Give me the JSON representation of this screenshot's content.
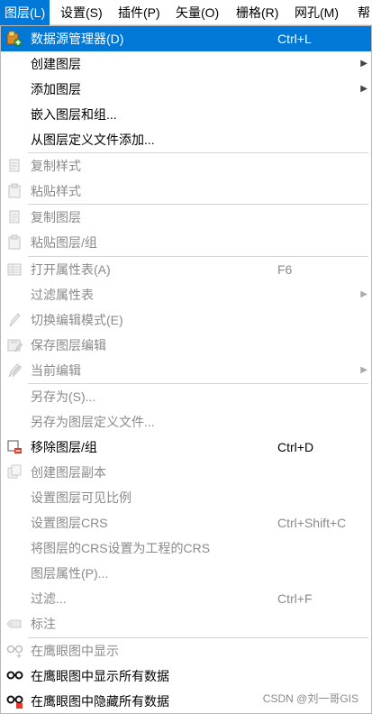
{
  "menubar": {
    "items": [
      "图层(L)",
      "设置(S)",
      "插件(P)",
      "矢量(O)",
      "栅格(R)",
      "网孔(M)",
      "帮"
    ]
  },
  "menu": {
    "items": [
      {
        "label": "数据源管理器(D)",
        "shortcut": "Ctrl+L",
        "icon": "data-source-manager-icon",
        "highlighted": true,
        "enabled": true
      },
      {
        "label": "创建图层",
        "submenu": true,
        "enabled": true
      },
      {
        "label": "添加图层",
        "submenu": true,
        "enabled": true
      },
      {
        "label": "嵌入图层和组...",
        "enabled": true
      },
      {
        "label": "从图层定义文件添加...",
        "enabled": true
      },
      {
        "label": "复制样式",
        "icon": "copy-icon",
        "enabled": false
      },
      {
        "label": "粘贴样式",
        "icon": "paste-icon",
        "enabled": false
      },
      {
        "label": "复制图层",
        "icon": "copy-icon",
        "enabled": false
      },
      {
        "label": "粘贴图层/组",
        "icon": "paste-icon",
        "enabled": false
      },
      {
        "label": "打开属性表(A)",
        "shortcut": "F6",
        "icon": "attribute-table-icon",
        "enabled": false
      },
      {
        "label": "过滤属性表",
        "submenu": true,
        "enabled": false
      },
      {
        "label": "切换编辑模式(E)",
        "icon": "pencil-icon",
        "enabled": false
      },
      {
        "label": "保存图层编辑",
        "icon": "save-edits-icon",
        "enabled": false
      },
      {
        "label": "当前编辑",
        "icon": "pencil-icon",
        "submenu": true,
        "enabled": false
      },
      {
        "label": "另存为(S)...",
        "enabled": false
      },
      {
        "label": "另存为图层定义文件...",
        "enabled": false
      },
      {
        "label": "移除图层/组",
        "shortcut": "Ctrl+D",
        "icon": "remove-layer-icon",
        "enabled": true
      },
      {
        "label": "创建图层副本",
        "icon": "duplicate-layer-icon",
        "enabled": false
      },
      {
        "label": "设置图层可见比例",
        "enabled": false
      },
      {
        "label": "设置图层CRS",
        "shortcut": "Ctrl+Shift+C",
        "enabled": false
      },
      {
        "label": "将图层的CRS设置为工程的CRS",
        "enabled": false
      },
      {
        "label": "图层属性(P)...",
        "enabled": false
      },
      {
        "label": "过滤...",
        "shortcut": "Ctrl+F",
        "enabled": false
      },
      {
        "label": "标注",
        "icon": "label-icon",
        "enabled": false
      },
      {
        "label": "在鹰眼图中显示",
        "icon": "overview-show-icon",
        "enabled": false
      },
      {
        "label": "在鹰眼图中显示所有数据",
        "icon": "overview-show-all-icon",
        "enabled": true
      },
      {
        "label": "在鹰眼图中隐藏所有数据",
        "icon": "overview-hide-all-icon",
        "enabled": true
      }
    ]
  },
  "watermark": "CSDN @刘一哥GIS",
  "colors": {
    "accent": "#0078d7",
    "disabled_text": "#8a8a8a"
  }
}
